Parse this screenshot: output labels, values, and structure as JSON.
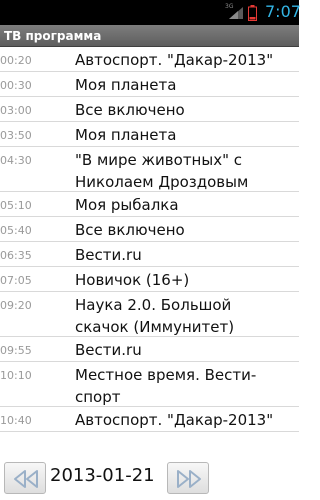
{
  "status_bar": {
    "network": "3G",
    "time": "7:07",
    "battery_color": "#e53935",
    "accent_color": "#33b5e5"
  },
  "title_bar": {
    "title": "ТВ программа"
  },
  "schedule": [
    {
      "time": "00:20",
      "title_lines": [
        "Автоспорт. \"Дакар-2013\""
      ]
    },
    {
      "time": "00:30",
      "title_lines": [
        "Моя планета"
      ]
    },
    {
      "time": "03:00",
      "title_lines": [
        "Все включено"
      ]
    },
    {
      "time": "03:50",
      "title_lines": [
        "Моя планета"
      ]
    },
    {
      "time": "04:30",
      "title_lines": [
        "\"В мире животных\" с",
        "Николаем Дроздовым"
      ]
    },
    {
      "time": "05:10",
      "title_lines": [
        "Моя рыбалка"
      ]
    },
    {
      "time": "05:40",
      "title_lines": [
        "Все включено"
      ]
    },
    {
      "time": "06:35",
      "title_lines": [
        "Вести.ru"
      ]
    },
    {
      "time": "07:05",
      "title_lines": [
        "Новичок (16+)"
      ]
    },
    {
      "time": "09:20",
      "title_lines": [
        "Наука 2.0. Большой",
        "скачок (Иммунитет)"
      ]
    },
    {
      "time": "09:55",
      "title_lines": [
        "Вести.ru"
      ]
    },
    {
      "time": "10:10",
      "title_lines": [
        "Местное время. Вести-",
        "спорт"
      ]
    },
    {
      "time": "10:40",
      "title_lines": [
        "Автоспорт. \"Дакар-2013\""
      ]
    }
  ],
  "date_nav": {
    "date": "2013-01-21",
    "prev_icon": "rewind-icon",
    "next_icon": "fast-forward-icon"
  }
}
